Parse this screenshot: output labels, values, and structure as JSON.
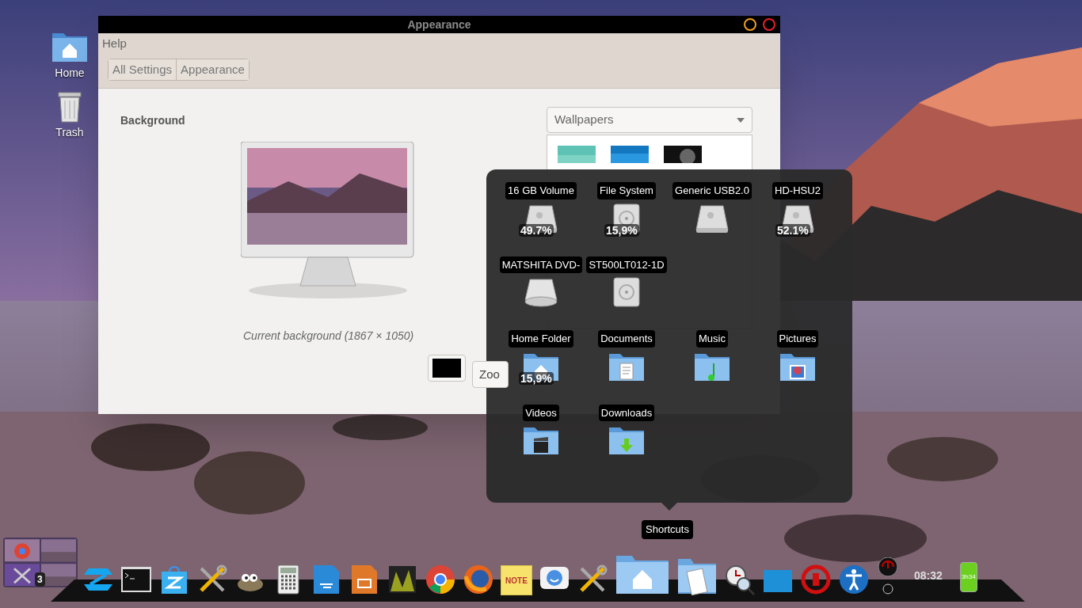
{
  "desktop_icons": [
    {
      "label": "Home",
      "kind": "home"
    },
    {
      "label": "Trash",
      "kind": "trash"
    }
  ],
  "window": {
    "title": "Appearance",
    "menu": [
      "Help"
    ],
    "breadcrumbs": [
      "All Settings",
      "Appearance"
    ],
    "section_title": "Background",
    "caption": "Current background (1867 × 1050)",
    "source_dropdown": "Wallpapers",
    "zoom_button": "Zoo"
  },
  "shortcuts_popup": {
    "devices": [
      {
        "label": "16 GB Volume",
        "usage": "49.7%",
        "kind": "usb"
      },
      {
        "label": "File System",
        "usage": "15,9%",
        "kind": "disk"
      },
      {
        "label": "Generic USB2.0",
        "kind": "usb"
      },
      {
        "label": "HD-HSU2",
        "usage": "52.1%",
        "kind": "usb"
      },
      {
        "label": "MATSHITA DVD-",
        "kind": "optical"
      },
      {
        "label": "ST500LT012-1D",
        "kind": "disk"
      }
    ],
    "places": [
      {
        "label": "Home Folder",
        "usage": "15,9%",
        "kind": "home"
      },
      {
        "label": "Documents",
        "kind": "documents"
      },
      {
        "label": "Music",
        "kind": "music"
      },
      {
        "label": "Pictures",
        "kind": "pictures"
      },
      {
        "label": "Videos",
        "kind": "videos"
      },
      {
        "label": "Downloads",
        "kind": "downloads"
      }
    ]
  },
  "tooltip": "Shortcuts",
  "workspaces": {
    "badge": "3"
  },
  "dock": {
    "items": [
      {
        "kind": "zorin"
      },
      {
        "kind": "terminal"
      },
      {
        "kind": "store"
      },
      {
        "kind": "tools"
      },
      {
        "kind": "gimp"
      },
      {
        "kind": "calculator"
      },
      {
        "kind": "writer"
      },
      {
        "kind": "impress"
      },
      {
        "kind": "viewer"
      },
      {
        "kind": "chrome"
      },
      {
        "kind": "firefox"
      },
      {
        "kind": "note",
        "label": "NOTE"
      },
      {
        "kind": "chat"
      },
      {
        "kind": "tools"
      },
      {
        "kind": "home"
      },
      {
        "kind": "documents"
      },
      {
        "kind": "clock"
      },
      {
        "kind": "screen"
      },
      {
        "kind": "power"
      },
      {
        "kind": "accessibility"
      },
      {
        "kind": "gauge"
      }
    ],
    "clock": "08:32",
    "battery": "3h34"
  }
}
